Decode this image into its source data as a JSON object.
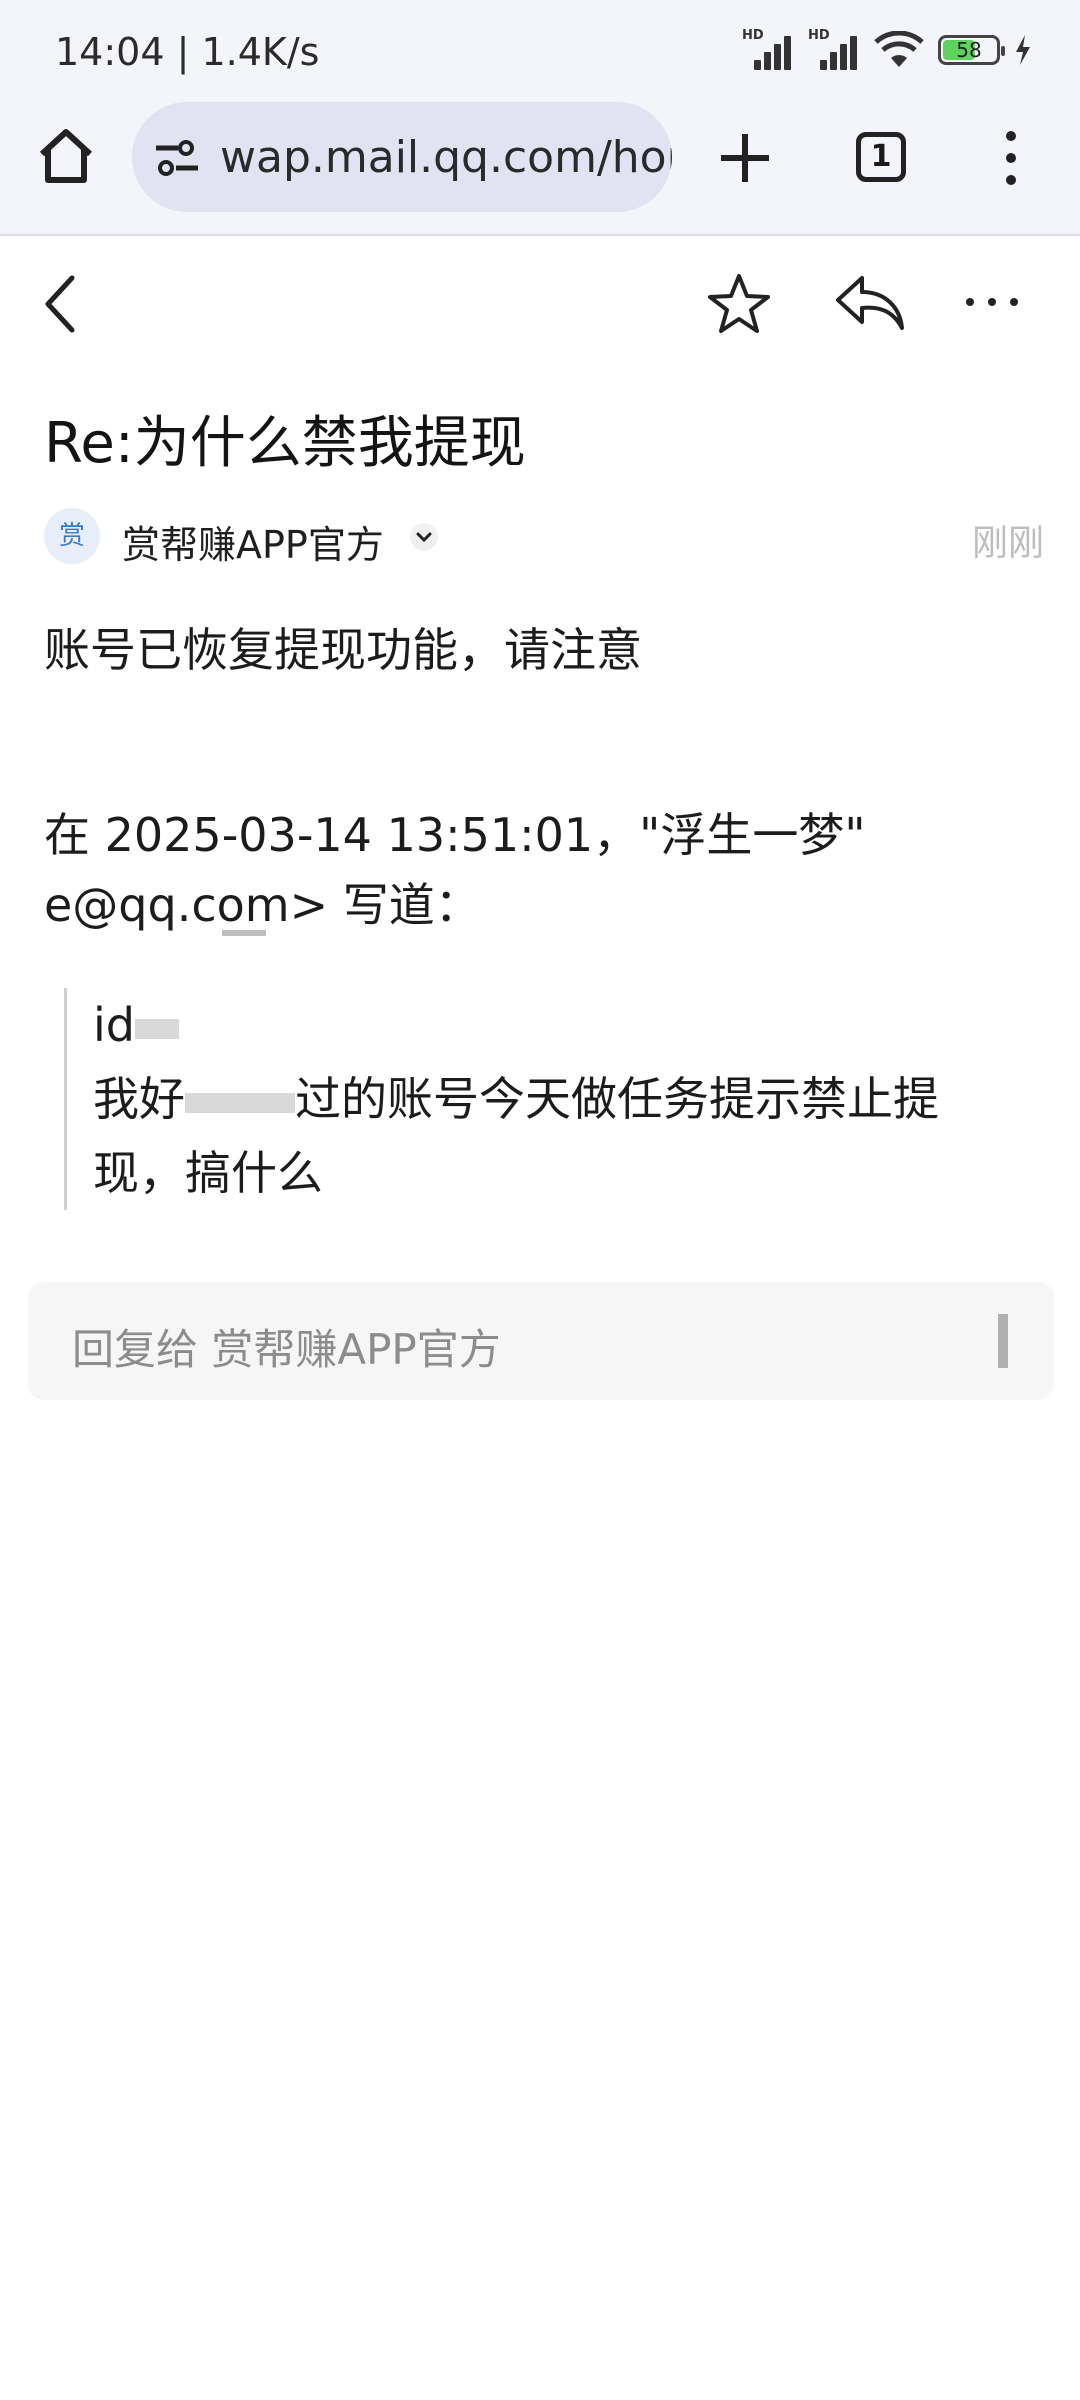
{
  "status_bar": {
    "time": "14:04 | 1.4K/s",
    "battery": "58",
    "signal_label": "HD"
  },
  "browser": {
    "url": "wap.mail.qq.com/home",
    "tab_count": "1"
  },
  "email": {
    "subject": "Re:为什么禁我提现",
    "sender_avatar": "赏",
    "sender": "赏帮赚APP官方",
    "time": "刚刚",
    "body": "账号已恢复提现功能，请注意",
    "quote_intro_line1": "在 2025-03-14 13:51:01，\"浮生一梦\"",
    "quote_intro_line2": "e@qq.com> 写道：",
    "quote_line1": "id",
    "quote_line2_a": "我好",
    "quote_line2_b": "过的账号今天做任务提示禁止提",
    "quote_line3": "现，搞什么"
  },
  "reply": {
    "placeholder": "回复给 赏帮赚APP官方"
  },
  "colors": {
    "browser_bg": "#f4f4fb",
    "urlbar_bg": "#e1e3f2",
    "avatar_text": "#3b79c9",
    "time_gray": "#bdbdbd"
  },
  "icons": [
    "home-icon",
    "site-settings-icon",
    "plus-icon",
    "tabs-icon",
    "overflow-menu-icon",
    "back-icon",
    "star-icon",
    "reply-icon",
    "more-icon",
    "chevron-down-icon"
  ]
}
